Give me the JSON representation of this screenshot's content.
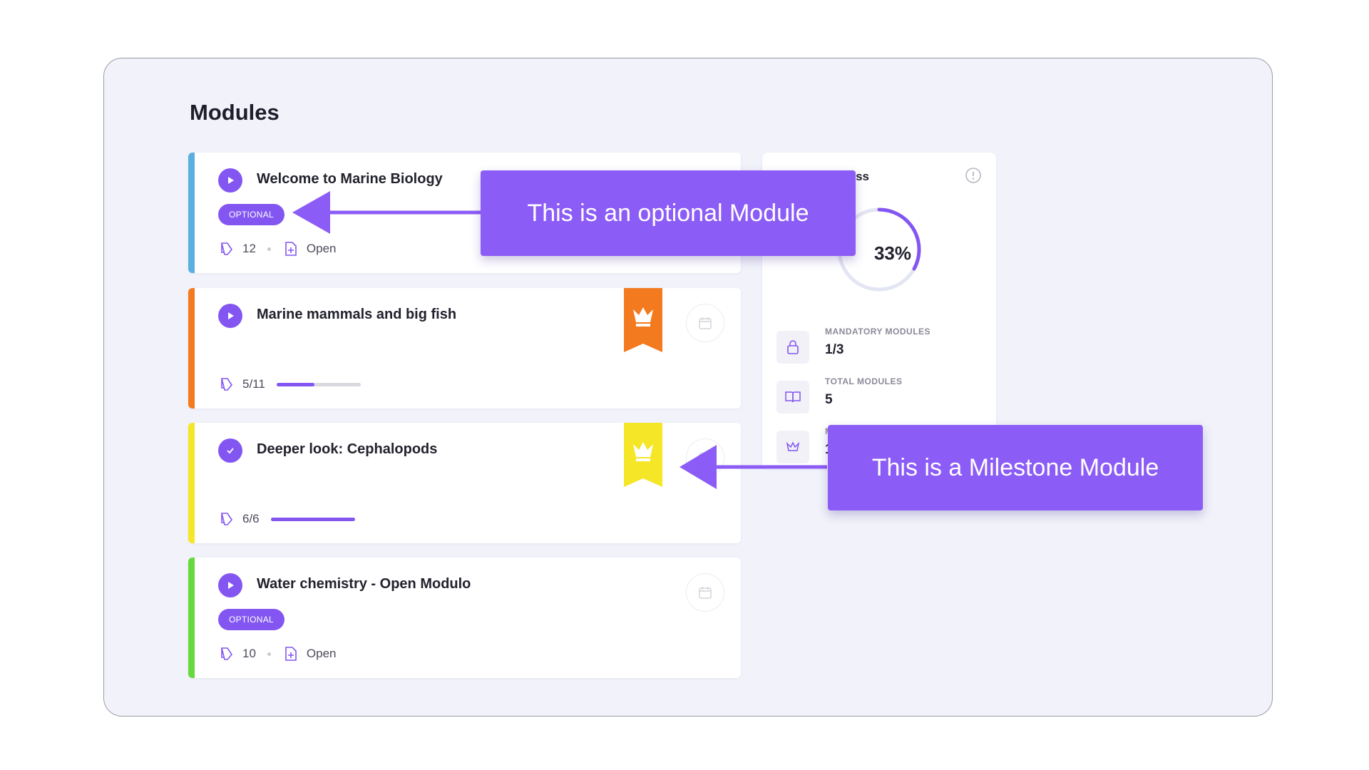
{
  "page": {
    "title": "Modules"
  },
  "modules": [
    {
      "title": "Welcome to Marine Biology",
      "badge": "OPTIONAL",
      "count": "12",
      "status": "Open",
      "stripe": "#5aafe0",
      "state": "play"
    },
    {
      "title": "Marine mammals and big fish",
      "progress_text": "5/11",
      "progress": 0.45,
      "stripe": "#f47a1f",
      "state": "play",
      "milestone_color": "#f47a1f"
    },
    {
      "title": "Deeper look: Cephalopods",
      "progress_text": "6/6",
      "progress": 1.0,
      "stripe": "#f5e627",
      "state": "done",
      "milestone_color": "#f5e627"
    },
    {
      "title": "Water chemistry - Open Modulo",
      "badge": "OPTIONAL",
      "count": "10",
      "status": "Open",
      "stripe": "#66d93c",
      "state": "play"
    }
  ],
  "progress_panel": {
    "title": "ss",
    "percent_label": "33%",
    "percent": 0.33,
    "stats": [
      {
        "label": "MANDATORY MODULES",
        "value": "1/3",
        "icon": "lock-icon"
      },
      {
        "label": "TOTAL MODULES",
        "value": "5",
        "icon": "book-icon"
      },
      {
        "label": "M",
        "value": "1",
        "icon": "crown-icon"
      }
    ]
  },
  "callouts": {
    "optional": "This is an optional Module",
    "milestone": "This is a Milestone Module"
  },
  "colors": {
    "accent": "#8356f2",
    "callout": "#8c5cf6",
    "background": "#f1f2fa"
  }
}
